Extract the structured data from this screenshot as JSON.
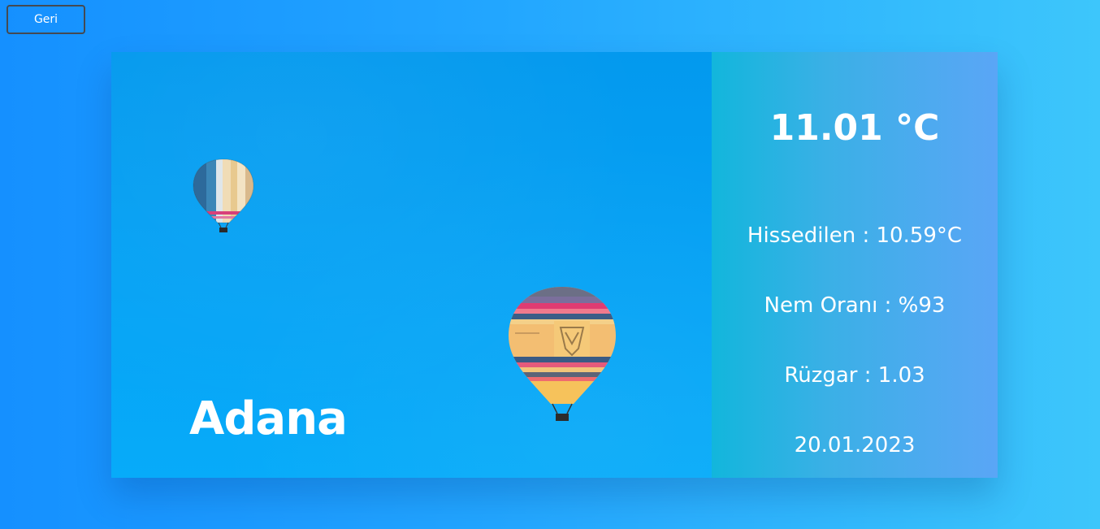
{
  "back_button": {
    "label": "Geri"
  },
  "city": {
    "name": "Adana"
  },
  "weather": {
    "temperature": "11.01 °C",
    "feels_like": {
      "label": "Hissedilen",
      "separator": " : ",
      "value": "10.59°C"
    },
    "humidity": {
      "label": "Nem Oranı",
      "separator": " : ",
      "value": "%93"
    },
    "wind": {
      "label": "Rüzgar",
      "separator": " : ",
      "value": "1.03"
    },
    "date": "20.01.2023"
  },
  "colors": {
    "background_start": "#1590ff",
    "background_end": "#3dc6fb",
    "photo_sky": "#06a3f5",
    "info_panel_start": "#12b6dc",
    "info_panel_end": "#5aa6f6",
    "text": "#ffffff"
  },
  "icons": {
    "small_balloon": "hot-air-balloon-icon",
    "large_balloon": "hot-air-balloon-icon"
  }
}
